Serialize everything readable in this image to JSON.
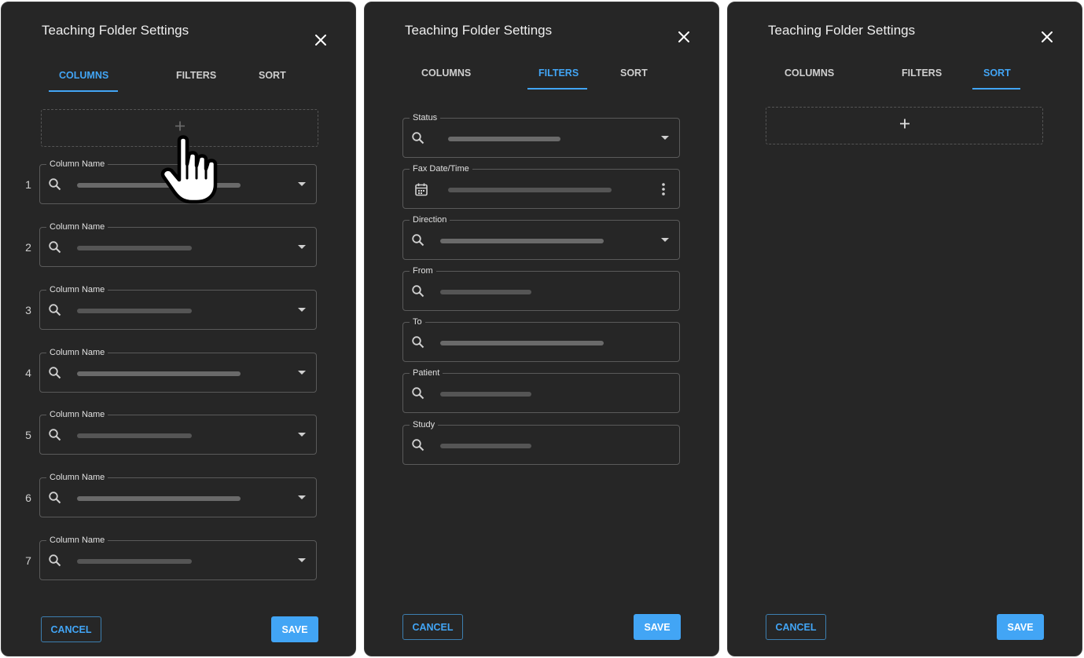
{
  "panels": [
    {
      "title": "Teaching Folder Settings",
      "tabs": [
        "COLUMNS",
        "FILTERS",
        "SORT"
      ],
      "active_tab": "COLUMNS",
      "rows": [
        {
          "index": "1",
          "label": "Column Name"
        },
        {
          "index": "2",
          "label": "Column Name"
        },
        {
          "index": "3",
          "label": "Column Name"
        },
        {
          "index": "4",
          "label": "Column Name"
        },
        {
          "index": "5",
          "label": "Column Name"
        },
        {
          "index": "6",
          "label": "Column Name"
        },
        {
          "index": "7",
          "label": "Column Name"
        }
      ],
      "cancel_label": "CANCEL",
      "save_label": "SAVE"
    },
    {
      "title": "Teaching Folder Settings",
      "tabs": [
        "COLUMNS",
        "FILTERS",
        "SORT"
      ],
      "active_tab": "FILTERS",
      "filters": [
        {
          "label": "Status",
          "icon": "search-icon",
          "control": "dropdown"
        },
        {
          "label": "Fax Date/Time",
          "icon": "calendar-icon",
          "control": "menu"
        },
        {
          "label": "Direction",
          "icon": "search-icon",
          "control": "dropdown"
        },
        {
          "label": "From",
          "icon": "search-icon",
          "control": "text"
        },
        {
          "label": "To",
          "icon": "search-icon",
          "control": "text"
        },
        {
          "label": "Patient",
          "icon": "search-icon",
          "control": "text"
        },
        {
          "label": "Study",
          "icon": "search-icon",
          "control": "text"
        }
      ],
      "cancel_label": "CANCEL",
      "save_label": "SAVE"
    },
    {
      "title": "Teaching Folder Settings",
      "tabs": [
        "COLUMNS",
        "FILTERS",
        "SORT"
      ],
      "active_tab": "SORT",
      "cancel_label": "CANCEL",
      "save_label": "SAVE"
    }
  ],
  "colors": {
    "panel_bg": "#262626",
    "accent": "#42a5f5",
    "placeholder_bar": "#6a6a6a",
    "border": "#5a5a5a"
  }
}
